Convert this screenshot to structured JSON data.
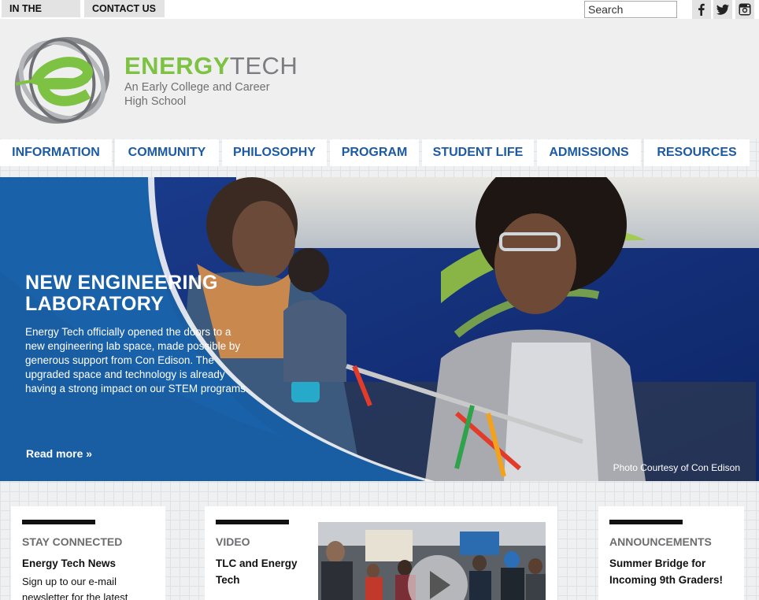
{
  "topbar": {
    "links": [
      "IN THE NEWS",
      "CONTACT US"
    ],
    "search_placeholder": "Search",
    "social": [
      "facebook-icon",
      "twitter-icon",
      "instagram-icon"
    ]
  },
  "brand": {
    "name_green": "ENERGY",
    "name_gray": "TECH",
    "subtitle": "An Early College and Career High School",
    "colors": {
      "green": "#7dc242",
      "gray": "#7b7d80",
      "blue": "#1c5aa3"
    }
  },
  "nav": [
    "INFORMATION",
    "COMMUNITY",
    "PHILOSOPHY",
    "PROGRAM",
    "STUDENT LIFE",
    "ADMISSIONS",
    "RESOURCES"
  ],
  "hero": {
    "title": "NEW ENGINEERING LABORATORY",
    "body": "Energy Tech officially opened the doors to a new engineering lab space, made possible by generous support from Con Edison. The upgraded space and technology is already having a strong impact on our STEM programs.",
    "read_more": "Read more »",
    "credit": "Photo Courtesy of Con Edison"
  },
  "cards": {
    "stay": {
      "label": "STAY CONNECTED",
      "headline": "Energy Tech News",
      "body": "Sign up to our e-mail newsletter for the latest"
    },
    "video": {
      "label": "VIDEO",
      "headline": "TLC and Energy Tech"
    },
    "announcements": {
      "label": "ANNOUNCEMENTS",
      "headline": "Summer Bridge for Incoming 9th Graders!"
    }
  }
}
